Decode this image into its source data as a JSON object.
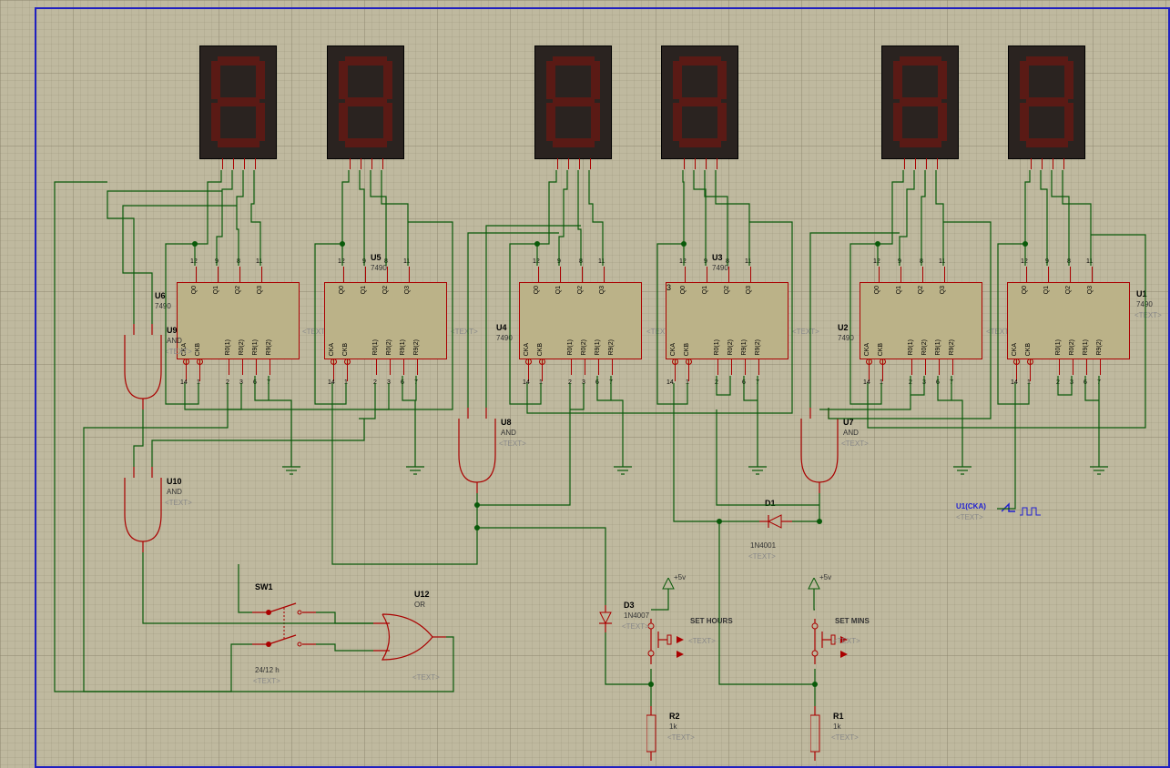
{
  "components": {
    "U1": {
      "ref": "U1",
      "part": "7490",
      "text": "<TEXT>",
      "pins_top": [
        "Q0",
        "Q1",
        "Q2",
        "Q3"
      ],
      "pins_top_num": [
        "12",
        "9",
        "8",
        "11"
      ],
      "pins_bot": [
        "CKA",
        "CKB",
        "R0(1)",
        "R0(2)",
        "R9(1)",
        "R9(2)"
      ],
      "pins_bot_num": [
        "14",
        "1",
        "2",
        "3",
        "6",
        "7"
      ]
    },
    "U2": {
      "ref": "U2",
      "part": "7490",
      "text": "<TEXT>"
    },
    "U3": {
      "ref": "U3",
      "part": "7490",
      "text": "<TEXT>"
    },
    "U4": {
      "ref": "U4",
      "part": "7490",
      "text": "<TEXT>"
    },
    "U5": {
      "ref": "U5",
      "part": "7490",
      "text": "<TEXT>"
    },
    "U6": {
      "ref": "U6",
      "part": "7490",
      "text": "<TEXT>"
    },
    "U7": {
      "ref": "U7",
      "part": "AND",
      "text": "<TEXT>"
    },
    "U8": {
      "ref": "U8",
      "part": "AND",
      "text": "<TEXT>"
    },
    "U9": {
      "ref": "U9",
      "part": "AND",
      "text": "<TEXT>"
    },
    "U10": {
      "ref": "U10",
      "part": "AND",
      "text": "<TEXT>"
    },
    "U12": {
      "ref": "U12",
      "part": "OR",
      "text": "<TEXT>"
    },
    "D1": {
      "ref": "D1",
      "part": "1N4001",
      "text": "<TEXT>"
    },
    "D3": {
      "ref": "D3",
      "part": "1N4007",
      "text": "<TEXT>"
    },
    "R1": {
      "ref": "R1",
      "part": "1k",
      "text": "<TEXT>"
    },
    "R2": {
      "ref": "R2",
      "part": "1k",
      "text": "<TEXT>"
    },
    "SW1": {
      "ref": "SW1",
      "part": "24/12 h",
      "text": "<TEXT>"
    },
    "SETH": {
      "label": "SET HOURS",
      "text": "<TEXT>"
    },
    "SETM": {
      "label": "SET MINS",
      "text": "<TEXT>"
    },
    "VCC1": {
      "label": "+5v"
    },
    "VCC2": {
      "label": "+5v"
    },
    "PROBE": {
      "label": "U1(CKA)",
      "text": "<TEXT>"
    }
  }
}
